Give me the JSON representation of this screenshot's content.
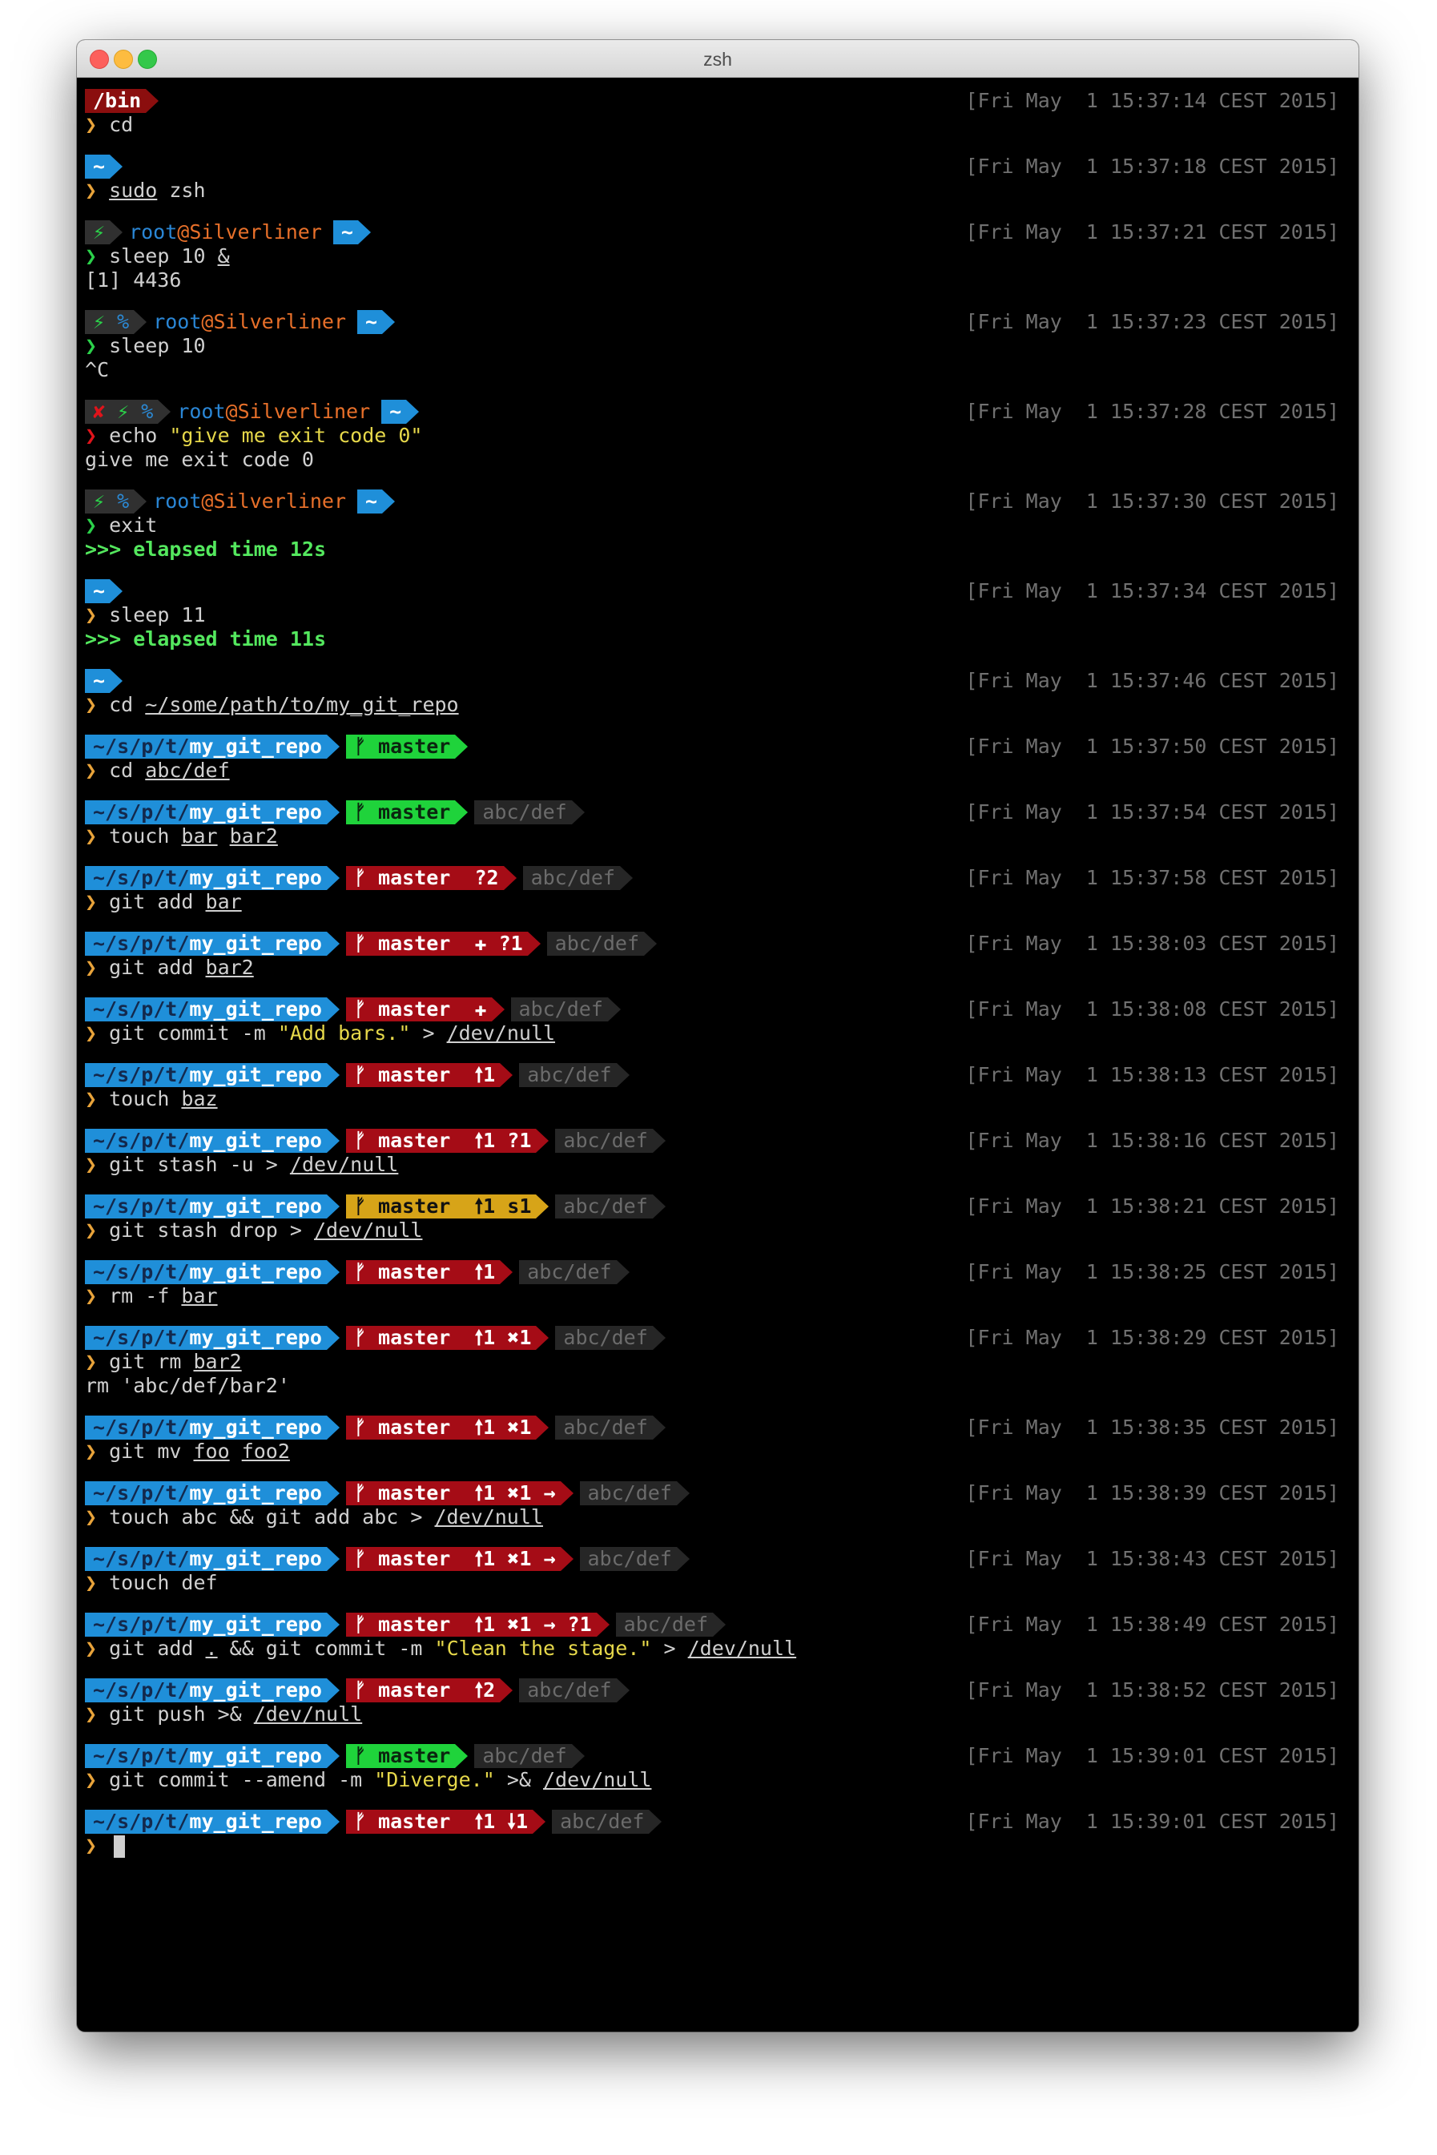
{
  "window": {
    "title": "zsh",
    "controls": [
      "close",
      "minimize",
      "zoom"
    ],
    "colors": {
      "close": "#fc605c",
      "minimize": "#fdbc40",
      "zoom": "#34c84a"
    }
  },
  "prompt_char": "❯",
  "blocks": [
    {
      "segs": [
        {
          "t": "bin",
          "text": "/bin"
        }
      ],
      "ts": "[Fri May  1 15:37:14 CEST 2015]",
      "arrow": "y",
      "cmd": "cd",
      "out": []
    },
    {
      "segs": [
        {
          "t": "home",
          "text": "~"
        }
      ],
      "ts": "[Fri May  1 15:37:18 CEST 2015]",
      "arrow": "y",
      "cmd": "sudo zsh",
      "out": []
    },
    {
      "status": "⚡",
      "user": "root",
      "host": "Silverliner",
      "segs": [
        {
          "t": "home",
          "text": "~"
        }
      ],
      "ts": "[Fri May  1 15:37:21 CEST 2015]",
      "arrow": "g",
      "cmd": "sleep 10 &",
      "out": [
        "[1] 4436"
      ]
    },
    {
      "status": "⚡ %",
      "user": "root",
      "host": "Silverliner",
      "segs": [
        {
          "t": "home",
          "text": "~"
        }
      ],
      "ts": "[Fri May  1 15:37:23 CEST 2015]",
      "arrow": "g",
      "cmd": "sleep 10",
      "out": [
        "^C"
      ]
    },
    {
      "status": "✘ ⚡ %",
      "user": "root",
      "host": "Silverliner",
      "segs": [
        {
          "t": "home",
          "text": "~"
        }
      ],
      "ts": "[Fri May  1 15:37:28 CEST 2015]",
      "arrow": "r",
      "cmd": "echo \"give me exit code 0\"",
      "out": [
        "give me exit code 0"
      ]
    },
    {
      "status": "⚡ %",
      "user": "root",
      "host": "Silverliner",
      "segs": [
        {
          "t": "home",
          "text": "~"
        }
      ],
      "ts": "[Fri May  1 15:37:30 CEST 2015]",
      "arrow": "g",
      "cmd": "exit",
      "out": [
        ">>> elapsed time 12s"
      ]
    },
    {
      "segs": [
        {
          "t": "home",
          "text": "~"
        }
      ],
      "ts": "[Fri May  1 15:37:34 CEST 2015]",
      "arrow": "y",
      "cmd": "sleep 11",
      "out": [
        ">>> elapsed time 11s"
      ]
    },
    {
      "segs": [
        {
          "t": "home",
          "text": "~"
        }
      ],
      "ts": "[Fri May  1 15:37:46 CEST 2015]",
      "arrow": "y",
      "cmd": "cd ~/some/path/to/my_git_repo",
      "out": []
    },
    {
      "segs": [
        {
          "t": "dir",
          "text": "~/s/p/t/my_git_repo"
        },
        {
          "t": "clean",
          "text": "ᚠ master"
        }
      ],
      "ts": "[Fri May  1 15:37:50 CEST 2015]",
      "arrow": "y",
      "cmd": "cd abc/def",
      "out": []
    },
    {
      "segs": [
        {
          "t": "dir",
          "text": "~/s/p/t/my_git_repo"
        },
        {
          "t": "clean",
          "text": "ᚠ master"
        },
        {
          "t": "path",
          "text": "abc/def"
        }
      ],
      "ts": "[Fri May  1 15:37:54 CEST 2015]",
      "arrow": "y",
      "cmd": "touch bar bar2",
      "out": []
    },
    {
      "segs": [
        {
          "t": "dir",
          "text": "~/s/p/t/my_git_repo"
        },
        {
          "t": "dirty",
          "text": "ᚠ master  ?2"
        },
        {
          "t": "path",
          "text": "abc/def"
        }
      ],
      "ts": "[Fri May  1 15:37:58 CEST 2015]",
      "arrow": "y",
      "cmd": "git add bar",
      "out": []
    },
    {
      "segs": [
        {
          "t": "dir",
          "text": "~/s/p/t/my_git_repo"
        },
        {
          "t": "dirty",
          "text": "ᚠ master  ✚ ?1"
        },
        {
          "t": "path",
          "text": "abc/def"
        }
      ],
      "ts": "[Fri May  1 15:38:03 CEST 2015]",
      "arrow": "y",
      "cmd": "git add bar2",
      "out": []
    },
    {
      "segs": [
        {
          "t": "dir",
          "text": "~/s/p/t/my_git_repo"
        },
        {
          "t": "dirty",
          "text": "ᚠ master  ✚"
        },
        {
          "t": "path",
          "text": "abc/def"
        }
      ],
      "ts": "[Fri May  1 15:38:08 CEST 2015]",
      "arrow": "y",
      "cmd": "git commit -m \"Add bars.\" > /dev/null",
      "out": []
    },
    {
      "segs": [
        {
          "t": "dir",
          "text": "~/s/p/t/my_git_repo"
        },
        {
          "t": "dirty",
          "text": "ᚠ master  🠕1"
        },
        {
          "t": "path",
          "text": "abc/def"
        }
      ],
      "ts": "[Fri May  1 15:38:13 CEST 2015]",
      "arrow": "y",
      "cmd": "touch baz",
      "out": []
    },
    {
      "segs": [
        {
          "t": "dir",
          "text": "~/s/p/t/my_git_repo"
        },
        {
          "t": "dirty",
          "text": "ᚠ master  🠕1 ?1"
        },
        {
          "t": "path",
          "text": "abc/def"
        }
      ],
      "ts": "[Fri May  1 15:38:16 CEST 2015]",
      "arrow": "y",
      "cmd": "git stash -u > /dev/null",
      "out": []
    },
    {
      "segs": [
        {
          "t": "dir",
          "text": "~/s/p/t/my_git_repo"
        },
        {
          "t": "stash",
          "text": "ᚠ master  🠕1 s1"
        },
        {
          "t": "path",
          "text": "abc/def"
        }
      ],
      "ts": "[Fri May  1 15:38:21 CEST 2015]",
      "arrow": "y",
      "cmd": "git stash drop > /dev/null",
      "out": []
    },
    {
      "segs": [
        {
          "t": "dir",
          "text": "~/s/p/t/my_git_repo"
        },
        {
          "t": "dirty",
          "text": "ᚠ master  🠕1"
        },
        {
          "t": "path",
          "text": "abc/def"
        }
      ],
      "ts": "[Fri May  1 15:38:25 CEST 2015]",
      "arrow": "y",
      "cmd": "rm -f bar",
      "out": []
    },
    {
      "segs": [
        {
          "t": "dir",
          "text": "~/s/p/t/my_git_repo"
        },
        {
          "t": "dirty",
          "text": "ᚠ master  🠕1 ✖1"
        },
        {
          "t": "path",
          "text": "abc/def"
        }
      ],
      "ts": "[Fri May  1 15:38:29 CEST 2015]",
      "arrow": "y",
      "cmd": "git rm bar2",
      "out": [
        "rm 'abc/def/bar2'"
      ]
    },
    {
      "segs": [
        {
          "t": "dir",
          "text": "~/s/p/t/my_git_repo"
        },
        {
          "t": "dirty",
          "text": "ᚠ master  🠕1 ✖1"
        },
        {
          "t": "path",
          "text": "abc/def"
        }
      ],
      "ts": "[Fri May  1 15:38:35 CEST 2015]",
      "arrow": "y",
      "cmd": "git mv foo foo2",
      "out": []
    },
    {
      "segs": [
        {
          "t": "dir",
          "text": "~/s/p/t/my_git_repo"
        },
        {
          "t": "dirty",
          "text": "ᚠ master  🠕1 ✖1 →"
        },
        {
          "t": "path",
          "text": "abc/def"
        }
      ],
      "ts": "[Fri May  1 15:38:39 CEST 2015]",
      "arrow": "y",
      "cmd": "touch abc && git add abc > /dev/null",
      "out": []
    },
    {
      "segs": [
        {
          "t": "dir",
          "text": "~/s/p/t/my_git_repo"
        },
        {
          "t": "dirty",
          "text": "ᚠ master  🠕1 ✖1 →"
        },
        {
          "t": "path",
          "text": "abc/def"
        }
      ],
      "ts": "[Fri May  1 15:38:43 CEST 2015]",
      "arrow": "y",
      "cmd": "touch def",
      "out": []
    },
    {
      "segs": [
        {
          "t": "dir",
          "text": "~/s/p/t/my_git_repo"
        },
        {
          "t": "dirty",
          "text": "ᚠ master  🠕1 ✖1 → ?1"
        },
        {
          "t": "path",
          "text": "abc/def"
        }
      ],
      "ts": "[Fri May  1 15:38:49 CEST 2015]",
      "arrow": "y",
      "cmd": "git add . && git commit -m \"Clean the stage.\" > /dev/null",
      "out": []
    },
    {
      "segs": [
        {
          "t": "dir",
          "text": "~/s/p/t/my_git_repo"
        },
        {
          "t": "dirty",
          "text": "ᚠ master  🠕2"
        },
        {
          "t": "path",
          "text": "abc/def"
        }
      ],
      "ts": "[Fri May  1 15:38:52 CEST 2015]",
      "arrow": "y",
      "cmd": "git push >& /dev/null",
      "out": []
    },
    {
      "segs": [
        {
          "t": "dir",
          "text": "~/s/p/t/my_git_repo"
        },
        {
          "t": "clean",
          "text": "ᚠ master"
        },
        {
          "t": "path",
          "text": "abc/def"
        }
      ],
      "ts": "[Fri May  1 15:39:01 CEST 2015]",
      "arrow": "y",
      "cmd": "git commit --amend -m \"Diverge.\" >& /dev/null",
      "out": []
    },
    {
      "segs": [
        {
          "t": "dir",
          "text": "~/s/p/t/my_git_repo"
        },
        {
          "t": "dirty",
          "text": "ᚠ master  🠕1 🠗1"
        },
        {
          "t": "path",
          "text": "abc/def"
        }
      ],
      "ts": "[Fri May  1 15:39:01 CEST 2015]",
      "arrow": "y",
      "cmd": "",
      "cursor": true,
      "out": []
    }
  ]
}
